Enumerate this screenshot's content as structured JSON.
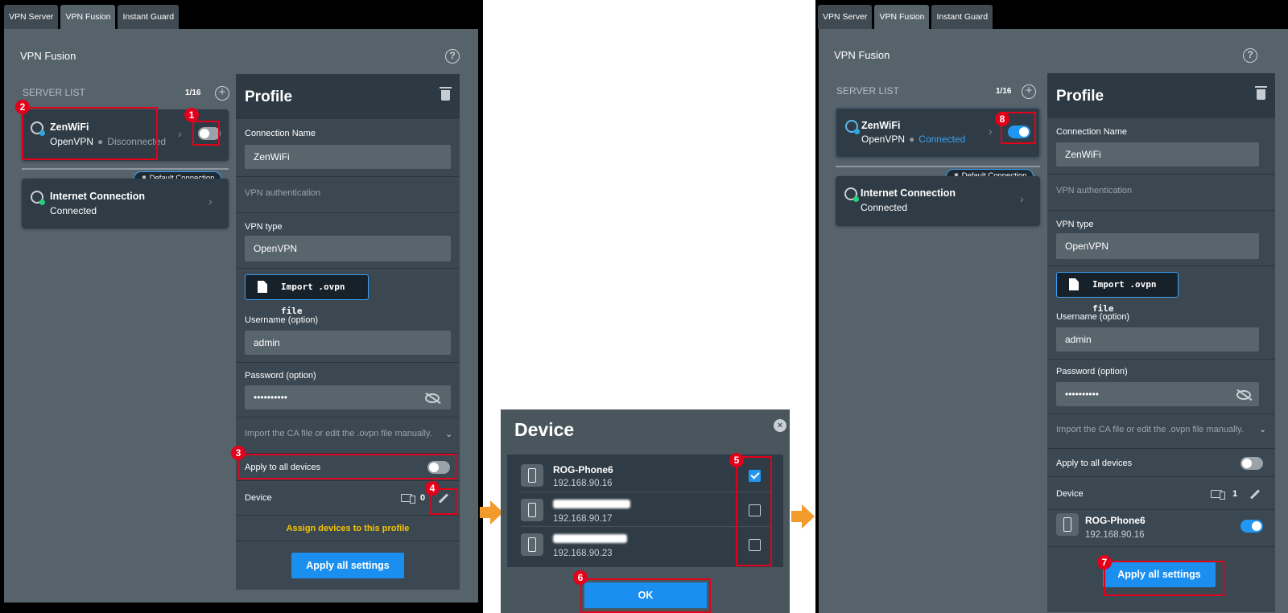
{
  "tabs": [
    "VPN Server",
    "VPN Fusion",
    "Instant Guard"
  ],
  "main_title": "VPN Fusion",
  "help_icon": "?",
  "server_list": {
    "label": "SERVER LIST",
    "count": "1/16",
    "add_icon": "+"
  },
  "server_vpn": {
    "name": "ZenWiFi",
    "protocol": "OpenVPN",
    "status_left": "Disconnected",
    "status_right": "Connected"
  },
  "default_badge": "Default Connection",
  "internet": {
    "name": "Internet Connection",
    "status": "Connected"
  },
  "profile": {
    "title": "Profile",
    "connection_name_label": "Connection Name",
    "connection_name_value": "ZenWiFi",
    "vpn_auth_label": "VPN authentication",
    "vpn_type_label": "VPN type",
    "vpn_type_value": "OpenVPN",
    "import_label": "Import .ovpn file",
    "username_label": "Username (option)",
    "username_value": "admin",
    "password_label": "Password (option)",
    "password_value": "••••••••••",
    "ca_label": "Import the CA file or edit the .ovpn file manually.",
    "apply_all_label": "Apply to all devices",
    "device_label": "Device",
    "device_count_left": "0",
    "device_count_right": "1",
    "assign_text": "Assign devices to this profile",
    "apply_button": "Apply all settings"
  },
  "dialog": {
    "title": "Device",
    "close_icon": "×",
    "devices": [
      {
        "name": "ROG-Phone6",
        "ip": "192.168.90.16",
        "checked": true
      },
      {
        "name": "",
        "ip": "192.168.90.17",
        "checked": false
      },
      {
        "name": "",
        "ip": "192.168.90.23",
        "checked": false
      }
    ],
    "ok_button": "OK"
  },
  "assigned_device": {
    "name": "ROG-Phone6",
    "ip": "192.168.90.16"
  },
  "step_numbers": [
    "1",
    "2",
    "3",
    "4",
    "5",
    "6",
    "7",
    "8"
  ],
  "colors": {
    "accent": "#1a8ff0",
    "annotation": "#e3001b",
    "arrow": "#f39a2d",
    "assign_text": "#f4c400"
  }
}
